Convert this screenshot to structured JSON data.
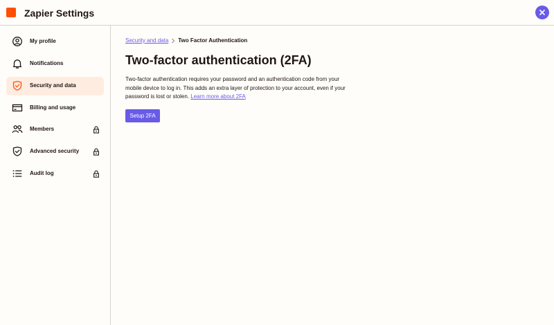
{
  "header": {
    "app_title": "Zapier Settings",
    "brand_color": "#ff4f00",
    "accent_color": "#695be8",
    "close_icon": "close-icon"
  },
  "sidebar": {
    "items": [
      {
        "label": "My profile",
        "icon": "user-circle-icon",
        "active": false,
        "locked": false
      },
      {
        "label": "Notifications",
        "icon": "bell-icon",
        "active": false,
        "locked": false
      },
      {
        "label": "Security and data",
        "icon": "shield-check-icon",
        "active": true,
        "locked": false
      },
      {
        "label": "Billing and usage",
        "icon": "credit-card-icon",
        "active": false,
        "locked": false
      },
      {
        "label": "Members",
        "icon": "users-icon",
        "active": false,
        "locked": true
      },
      {
        "label": "Advanced security",
        "icon": "shield-check-icon",
        "active": false,
        "locked": true
      },
      {
        "label": "Audit log",
        "icon": "list-icon",
        "active": false,
        "locked": true
      }
    ]
  },
  "main": {
    "breadcrumb": {
      "parent": "Security and data",
      "current": "Two Factor Authentication"
    },
    "title": "Two-factor authentication (2FA)",
    "description": "Two-factor authentication requires your password and an authentication code from your mobile device to log in. This adds an extra layer of protection to your account, even if your password is lost or stolen.",
    "learn_more_link": "Learn more about 2FA",
    "setup_button": "Setup 2FA"
  }
}
